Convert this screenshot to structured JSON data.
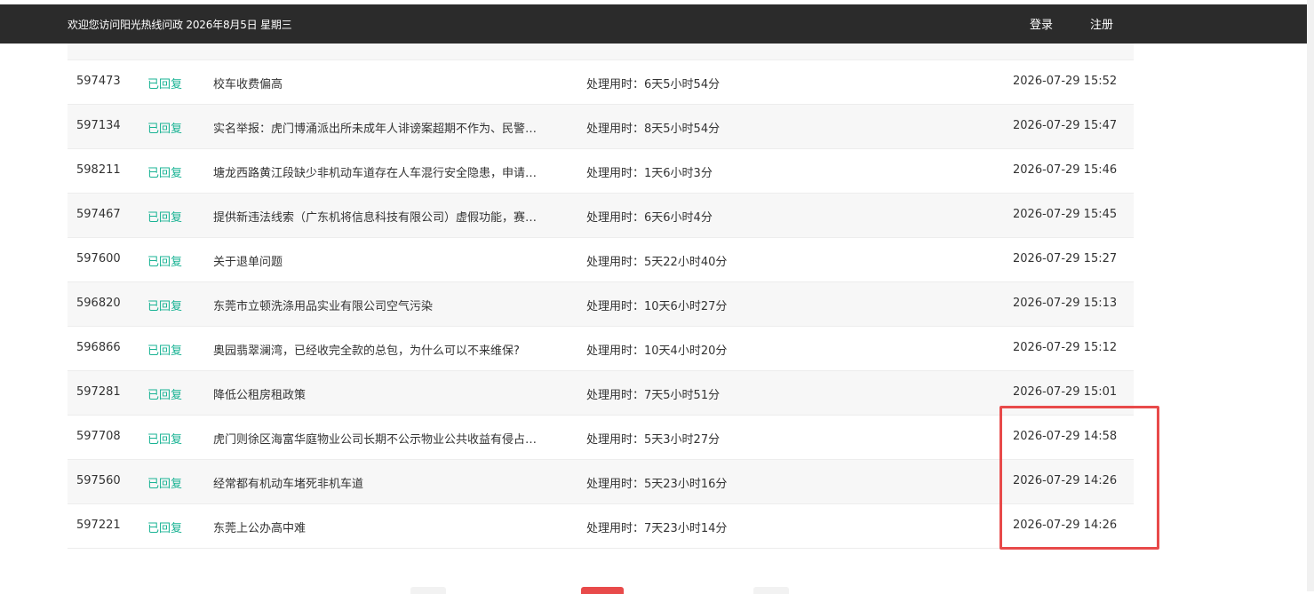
{
  "header": {
    "welcome": "欢迎您访问阳光热线问政 2026年8月5日 星期三",
    "login": "登录",
    "register": "注册"
  },
  "list": {
    "rows": [
      {
        "id": "597473",
        "status": "已回复",
        "title": "校车收费偏高",
        "time": "处理用时：6天5小时54分",
        "date": "2026-07-29 15:52"
      },
      {
        "id": "597134",
        "status": "已回复",
        "title": "实名举报：虎门博涌派出所未成年人诽谤案超期不作为、民警…",
        "time": "处理用时：8天5小时54分",
        "date": "2026-07-29 15:47"
      },
      {
        "id": "598211",
        "status": "已回复",
        "title": "塘龙西路黄江段缺少非机动车道存在人车混行安全隐患，申请…",
        "time": "处理用时：1天6小时3分",
        "date": "2026-07-29 15:46"
      },
      {
        "id": "597467",
        "status": "已回复",
        "title": "提供新违法线索（广东机将信息科技有限公司）虚假功能，赛…",
        "time": "处理用时：6天6小时4分",
        "date": "2026-07-29 15:45"
      },
      {
        "id": "597600",
        "status": "已回复",
        "title": "关于退单问题",
        "time": "处理用时：5天22小时40分",
        "date": "2026-07-29 15:27"
      },
      {
        "id": "596820",
        "status": "已回复",
        "title": "东莞市立顿洗涤用品实业有限公司空气污染",
        "time": "处理用时：10天6小时27分",
        "date": "2026-07-29 15:13"
      },
      {
        "id": "596866",
        "status": "已回复",
        "title": "奥园翡翠澜湾，已经收完全款的总包，为什么可以不来维保?",
        "time": "处理用时：10天4小时20分",
        "date": "2026-07-29 15:12"
      },
      {
        "id": "597281",
        "status": "已回复",
        "title": "降低公租房租政策",
        "time": "处理用时：7天5小时51分",
        "date": "2026-07-29 15:01"
      },
      {
        "id": "597708",
        "status": "已回复",
        "title": "虎门则徐区海富华庭物业公司长期不公示物业公共收益有侵占…",
        "time": "处理用时：5天3小时27分",
        "date": "2026-07-29 14:58"
      },
      {
        "id": "597560",
        "status": "已回复",
        "title": "经常都有机动车堵死非机车道",
        "time": "处理用时：5天23小时16分",
        "date": "2026-07-29 14:26"
      },
      {
        "id": "597221",
        "status": "已回复",
        "title": "东莞上公办高中难",
        "time": "处理用时：7天23小时14分",
        "date": "2026-07-29 14:26"
      }
    ]
  },
  "colors": {
    "header_bg": "#2b2b2b",
    "status_green": "#1ab394",
    "highlight_red": "#e84a4a",
    "alt_row_bg": "#f7f7f7"
  }
}
